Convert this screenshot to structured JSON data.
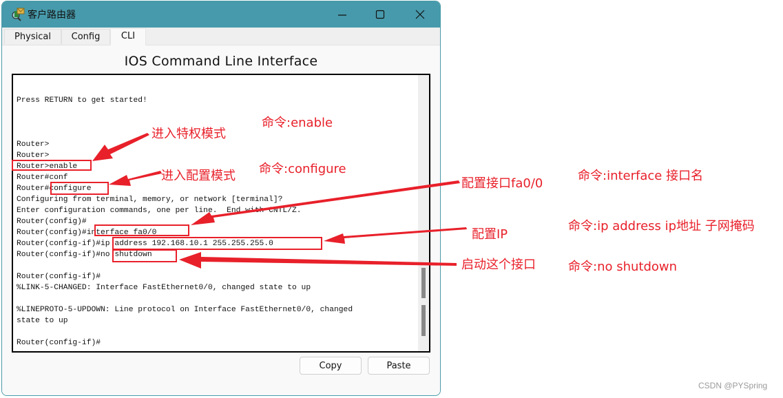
{
  "window": {
    "title": "客户路由器",
    "controls": {
      "minimize": "minimize",
      "maximize": "maximize",
      "close": "close"
    }
  },
  "tabs": [
    {
      "label": "Physical",
      "active": false
    },
    {
      "label": "Config",
      "active": false
    },
    {
      "label": "CLI",
      "active": true
    }
  ],
  "cli": {
    "heading": "IOS Command Line Interface",
    "terminal_lines": [
      "Press RETURN to get started!",
      "",
      "",
      "",
      "Router>",
      "Router>",
      "Router>enable",
      "Router#conf",
      "Router#configure",
      "Configuring from terminal, memory, or network [terminal]?",
      "Enter configuration commands, one per line.  End with CNTL/Z.",
      "Router(config)#",
      "Router(config)#interface fa0/0",
      "Router(config-if)#ip address 192.168.10.1 255.255.255.0",
      "Router(config-if)#no shutdown",
      "",
      "Router(config-if)#",
      "%LINK-5-CHANGED: Interface FastEthernet0/0, changed state to up",
      "",
      "%LINEPROTO-5-UPDOWN: Line protocol on Interface FastEthernet0/0, changed",
      "state to up",
      "",
      "Router(config-if)#"
    ],
    "copy_label": "Copy",
    "paste_label": "Paste"
  },
  "annotations": {
    "color": "#e8202a",
    "labels": [
      {
        "id": "enter-privileged",
        "text": "进入特权模式"
      },
      {
        "id": "cmd-enable",
        "text": "命令:enable"
      },
      {
        "id": "enter-config",
        "text": "进入配置模式"
      },
      {
        "id": "cmd-configure",
        "text": "命令:configure"
      },
      {
        "id": "config-interface",
        "text": "配置接口fa0/0"
      },
      {
        "id": "cmd-interface",
        "text": "命令:interface 接口名"
      },
      {
        "id": "config-ip",
        "text": "配置IP"
      },
      {
        "id": "cmd-ip",
        "text": "命令:ip address ip地址 子网掩码"
      },
      {
        "id": "enable-interface",
        "text": "启动这个接口"
      },
      {
        "id": "cmd-noshut",
        "text": "命令:no shutdown"
      }
    ]
  },
  "watermark": "CSDN @PYSpring"
}
